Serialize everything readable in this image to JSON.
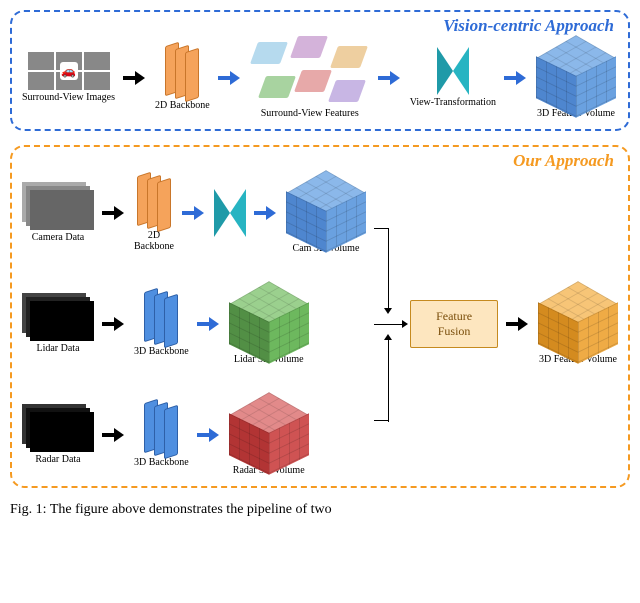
{
  "panels": {
    "vision": {
      "title": "Vision-centric Approach"
    },
    "ours": {
      "title": "Our Approach"
    }
  },
  "labels": {
    "surround_images": "Surround-View Images",
    "backbone2d": "2D Backbone",
    "surround_features": "Surround-View Features",
    "view_transform": "View-Transformation",
    "feat_volume_3d": "3D Feature Volume",
    "camera_data": "Camera Data",
    "cam_3d_volume": "Cam 3D Volume",
    "lidar_data": "Lidar Data",
    "backbone3d": "3D Backbone",
    "lidar_3d_volume": "Lidar 3D Volume",
    "radar_data": "Radar Data",
    "radar_3d_volume": "Radar 3D Volume",
    "feature_fusion": "Feature Fusion"
  },
  "caption": "Fig. 1: The figure above demonstrates the pipeline of two",
  "colors": {
    "feat_patches": [
      "#b6daee",
      "#d4b3da",
      "#a8d3a0",
      "#eecfa0",
      "#c8b6e4",
      "#e7a9a9"
    ]
  }
}
